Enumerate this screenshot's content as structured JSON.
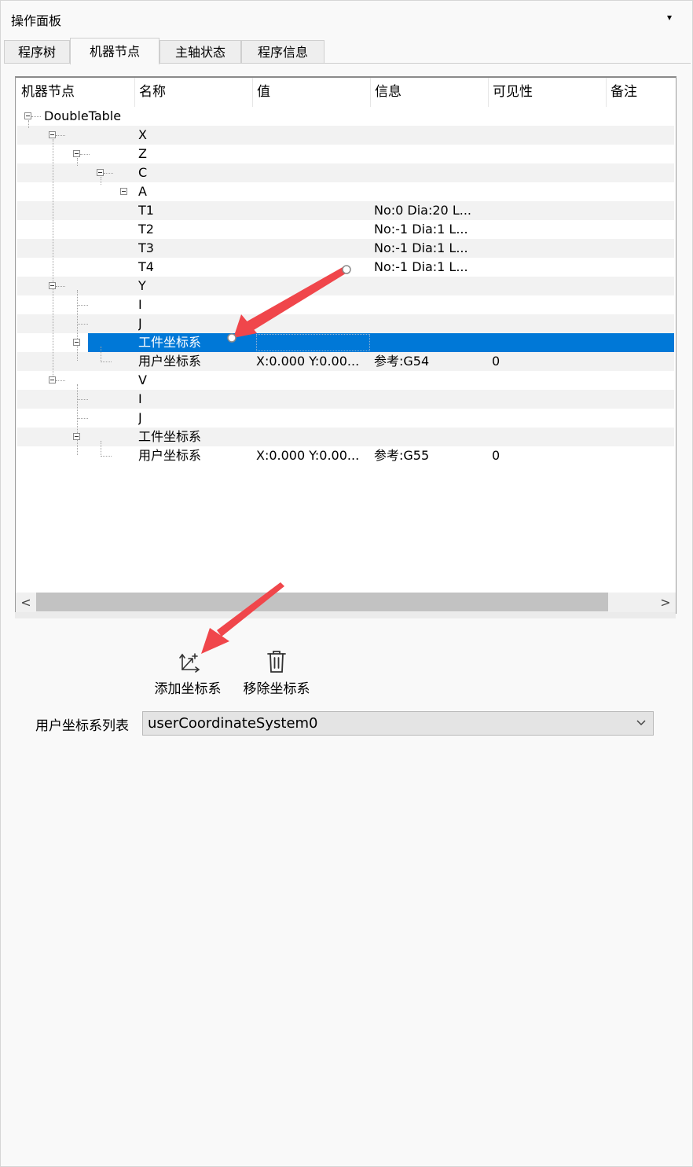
{
  "panel": {
    "title": "操作面板",
    "menu_glyph": "▾"
  },
  "tabs": [
    {
      "label": "程序树"
    },
    {
      "label": "机器节点"
    },
    {
      "label": "主轴状态"
    },
    {
      "label": "程序信息"
    }
  ],
  "grid": {
    "columns": [
      "机器节点",
      "名称",
      "值",
      "信息",
      "可见性",
      "备注"
    ],
    "root": "DoubleTable",
    "rows": [
      {
        "name": "X",
        "value": "",
        "info": "",
        "visibility": ""
      },
      {
        "name": "Z",
        "value": "",
        "info": "",
        "visibility": ""
      },
      {
        "name": "C",
        "value": "",
        "info": "",
        "visibility": ""
      },
      {
        "name": "A",
        "value": "",
        "info": "",
        "visibility": ""
      },
      {
        "name": "T1",
        "value": "",
        "info": "No:0  Dia:20  L...",
        "visibility": ""
      },
      {
        "name": "T2",
        "value": "",
        "info": "No:-1  Dia:1  L...",
        "visibility": ""
      },
      {
        "name": "T3",
        "value": "",
        "info": "No:-1  Dia:1  L...",
        "visibility": ""
      },
      {
        "name": "T4",
        "value": "",
        "info": "No:-1  Dia:1  L...",
        "visibility": ""
      },
      {
        "name": "Y",
        "value": "",
        "info": "",
        "visibility": ""
      },
      {
        "name": "I",
        "value": "",
        "info": "",
        "visibility": ""
      },
      {
        "name": "J",
        "value": "",
        "info": "",
        "visibility": ""
      },
      {
        "name": "工件坐标系",
        "value": "",
        "info": "",
        "visibility": ""
      },
      {
        "name": "用户坐标系",
        "value": "X:0.000 Y:0.00...",
        "info": "参考:G54",
        "visibility": "0"
      },
      {
        "name": "V",
        "value": "",
        "info": "",
        "visibility": ""
      },
      {
        "name": "I",
        "value": "",
        "info": "",
        "visibility": ""
      },
      {
        "name": "J",
        "value": "",
        "info": "",
        "visibility": ""
      },
      {
        "name": "工件坐标系",
        "value": "",
        "info": "",
        "visibility": ""
      },
      {
        "name": "用户坐标系",
        "value": "X:0.000 Y:0.00...",
        "info": "参考:G55",
        "visibility": "0"
      }
    ],
    "selected_row": "工件坐标系"
  },
  "scrollbar": {
    "left_glyph": "<",
    "right_glyph": ">"
  },
  "toolbar": {
    "add_label": "添加坐标系",
    "add_icon": "axes-icon",
    "remove_label": "移除坐标系",
    "remove_icon": "trash-icon"
  },
  "combo": {
    "label": "用户坐标系列表",
    "value": "userCoordinateSystem0"
  },
  "colors": {
    "selection": "#0078d7",
    "annotation_arrow": "#f0464b"
  }
}
